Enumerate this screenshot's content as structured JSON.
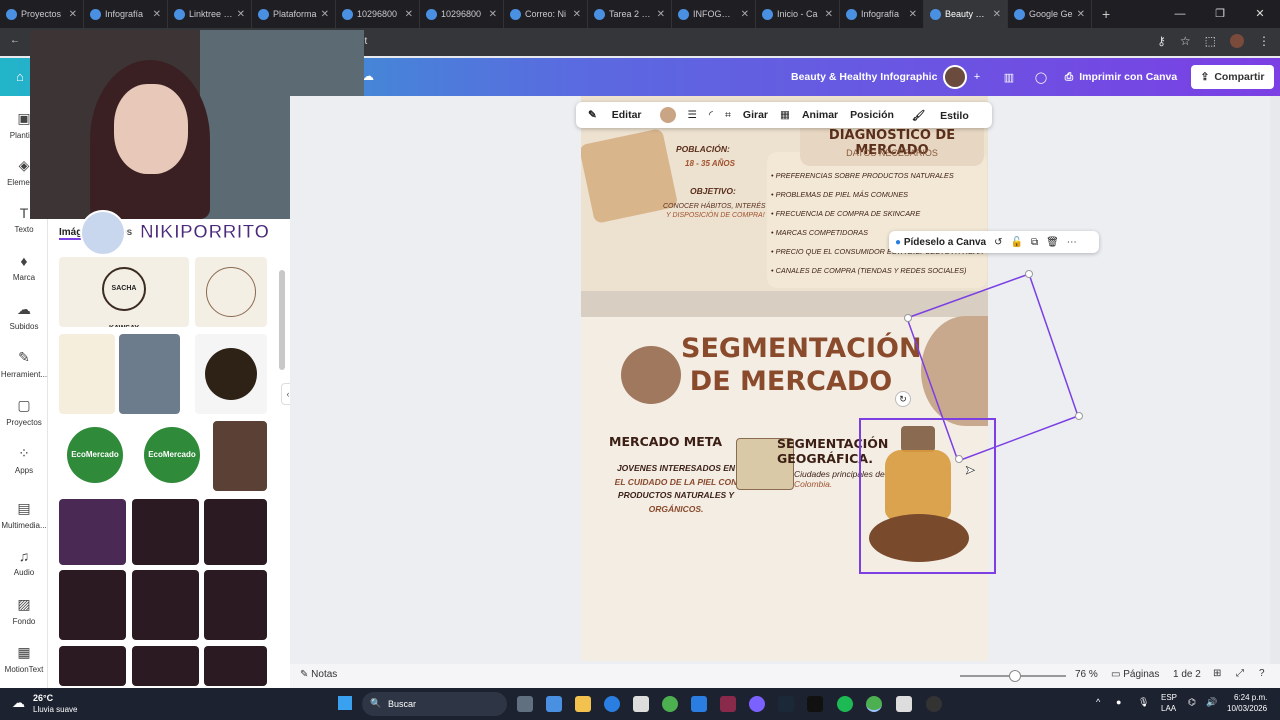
{
  "tabs": [
    {
      "label": "Proyectos"
    },
    {
      "label": "Infografía"
    },
    {
      "label": "Linktree | L"
    },
    {
      "label": "Plataforma"
    },
    {
      "label": "10296800"
    },
    {
      "label": "10296800"
    },
    {
      "label": "Correo: Ni"
    },
    {
      "label": "Tarea 2 - E"
    },
    {
      "label": "INFOGRAF"
    },
    {
      "label": "Inicio - Ca"
    },
    {
      "label": "Infografía"
    },
    {
      "label": "Beauty & H"
    },
    {
      "label": "Google Ge"
    }
  ],
  "browser": {
    "url_fragment": "lit"
  },
  "header": {
    "title": "Beauty & Healthy Infographic",
    "print_label": "Imprimir con Canva",
    "share_label": "Compartir"
  },
  "nav": [
    {
      "label": "Plantil..."
    },
    {
      "label": "Elemen..."
    },
    {
      "label": "Texto"
    },
    {
      "label": "Marca"
    },
    {
      "label": "Subidos"
    },
    {
      "label": "Herramient..."
    },
    {
      "label": "Proyectos"
    },
    {
      "label": "Apps"
    },
    {
      "label": "Multimedia..."
    },
    {
      "label": "Audio"
    },
    {
      "label": "Fondo"
    },
    {
      "label": "MotionText"
    }
  ],
  "panel": {
    "tab_images": "Imág",
    "tab_videos": "eos",
    "streamer": "NIKIPORRITO",
    "logo_text": "SACHA KAWSAY",
    "eco_text": "EcoMercado"
  },
  "toolbar": {
    "edit": "Editar",
    "rotate": "Girar",
    "animate": "Animar",
    "position": "Posición",
    "style": "Estilo"
  },
  "selection": {
    "ask": "Pídeselo a Canva"
  },
  "design": {
    "diag_title": "DIAGNÓSTICO DE MERCADO",
    "diag_sub": "DATOS NECESARIOS",
    "pop_label": "POBLACIÓN:",
    "pop_value": "18 - 35 AÑOS",
    "obj_label": "OBJETIVO:",
    "obj_line1": "CONOCER HÁBITOS, INTERÉS",
    "obj_line2": "Y DISPOSICIÓN DE COMPRA!",
    "bullets": [
      "PREFERENCIAS SOBRE PRODUCTOS NATURALES",
      "PROBLEMAS DE PIEL MÁS COMUNES",
      "FRECUENCIA DE COMPRA DE SKINCARE",
      "MARCAS COMPETIDORAS",
      "PRECIO QUE EL CONSUMIDOR ESTÁ DISPUESTO A PAGAR",
      "CANALES DE COMPRA (TIENDAS Y REDES SOCIALES)"
    ],
    "seg_title1": "SEGMENTACIÓN",
    "seg_title2": "DE MERCADO",
    "meta_title": "MERCADO META",
    "meta_l1": "JOVENES INTERESADOS EN",
    "meta_l2": "EL CUIDADO DE LA PIEL CON",
    "meta_l3": "PRODUCTOS NATURALES Y",
    "meta_l4": "ORGÁNICOS.",
    "geo_title1": "SEGMENTACIÓN",
    "geo_title2": "GEOGRÁFICA.",
    "geo_l1": "Ciudades principales de",
    "geo_l2": "Colombia."
  },
  "bottom": {
    "notes": "Notas",
    "zoom": "76 %",
    "pages": "Páginas",
    "page_count": "1 de 2"
  },
  "taskbar": {
    "temp": "26°C",
    "weather": "Lluvia suave",
    "search": "Buscar",
    "lang1": "ESP",
    "lang2": "LAA",
    "time": "6:24 p.m.",
    "date": "10/03/2026"
  },
  "colors": {
    "accent": "#7b3fe4",
    "brown": "#8a4a2c",
    "beige": "#f3ede4"
  }
}
